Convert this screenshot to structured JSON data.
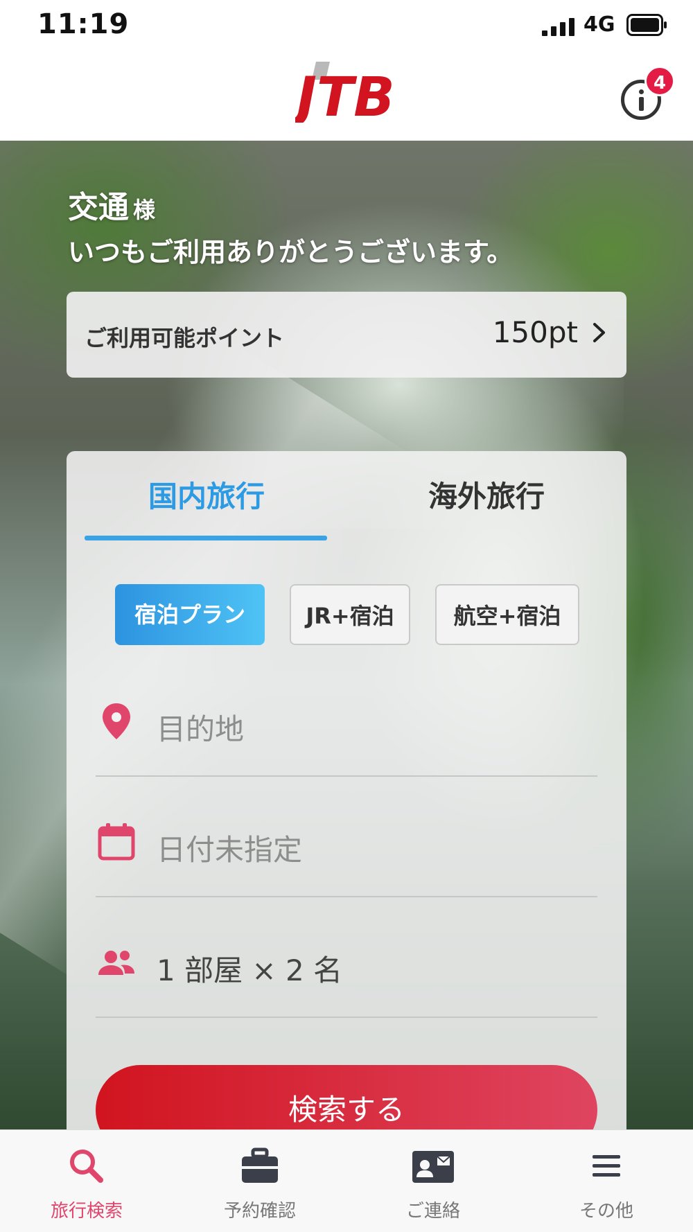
{
  "status_bar": {
    "time": "11:19",
    "network": "4G"
  },
  "header": {
    "logo_text": "JTB",
    "notification_count": "4"
  },
  "greeting": {
    "name": "交通",
    "honorific": "様",
    "message": "いつもご利用ありがとうございます。"
  },
  "points": {
    "label": "ご利用可能ポイント",
    "value": "150pt"
  },
  "search": {
    "tabs": [
      "国内旅行",
      "海外旅行"
    ],
    "active_tab": "国内旅行",
    "plan_types": [
      "宿泊プラン",
      "JR+宿泊",
      "航空+宿泊"
    ],
    "destination_placeholder": "目的地",
    "date_placeholder": "日付未指定",
    "guests_value": "1 部屋 × 2 名",
    "submit_label": "検索する"
  },
  "bottom_nav": {
    "items": [
      {
        "label": "旅行検索",
        "icon": "search-icon"
      },
      {
        "label": "予約確認",
        "icon": "briefcase-icon"
      },
      {
        "label": "ご連絡",
        "icon": "contact-card-icon"
      },
      {
        "label": "その他",
        "icon": "menu-icon"
      }
    ],
    "active_index": 0
  },
  "colors": {
    "accent_blue": "#2d9be3",
    "brand_red": "#d1141f",
    "nav_active": "#e0456b",
    "icon_pink": "#e0456b"
  }
}
